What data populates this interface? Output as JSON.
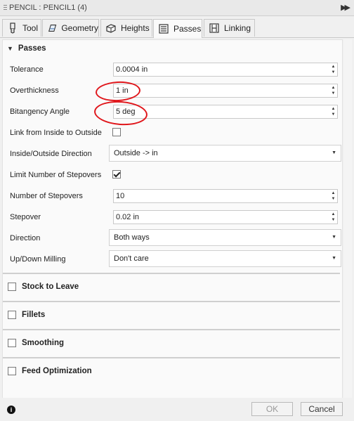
{
  "window": {
    "title": "PENCIL : PENCIL1 (4)"
  },
  "tabs": [
    {
      "label": "Tool",
      "icon": "tool-icon"
    },
    {
      "label": "Geometry",
      "icon": "geometry-icon"
    },
    {
      "label": "Heights",
      "icon": "heights-icon"
    },
    {
      "label": "Passes",
      "icon": "passes-icon",
      "active": true
    },
    {
      "label": "Linking",
      "icon": "linking-icon"
    }
  ],
  "passes": {
    "heading": "Passes",
    "tolerance": {
      "label": "Tolerance",
      "value": "0.0004 in"
    },
    "overthickness": {
      "label": "Overthickness",
      "value": "1 in"
    },
    "bitangency": {
      "label": "Bitangency Angle",
      "value": "5 deg"
    },
    "link_inside": {
      "label": "Link from Inside to Outside",
      "checked": false
    },
    "inside_outside": {
      "label": "Inside/Outside Direction",
      "value": "Outside -> in"
    },
    "limit_stepovers": {
      "label": "Limit Number of Stepovers",
      "checked": true
    },
    "num_stepovers": {
      "label": "Number of Stepovers",
      "value": "10"
    },
    "stepover": {
      "label": "Stepover",
      "value": "0.02 in"
    },
    "direction": {
      "label": "Direction",
      "value": "Both ways"
    },
    "updown": {
      "label": "Up/Down Milling",
      "value": "Don't care"
    }
  },
  "sections": [
    {
      "label": "Stock to Leave"
    },
    {
      "label": "Fillets"
    },
    {
      "label": "Smoothing"
    },
    {
      "label": "Feed Optimization"
    }
  ],
  "footer": {
    "ok": "OK",
    "cancel": "Cancel",
    "info": "i"
  },
  "colors": {
    "highlight_ring": "#e0161b"
  }
}
